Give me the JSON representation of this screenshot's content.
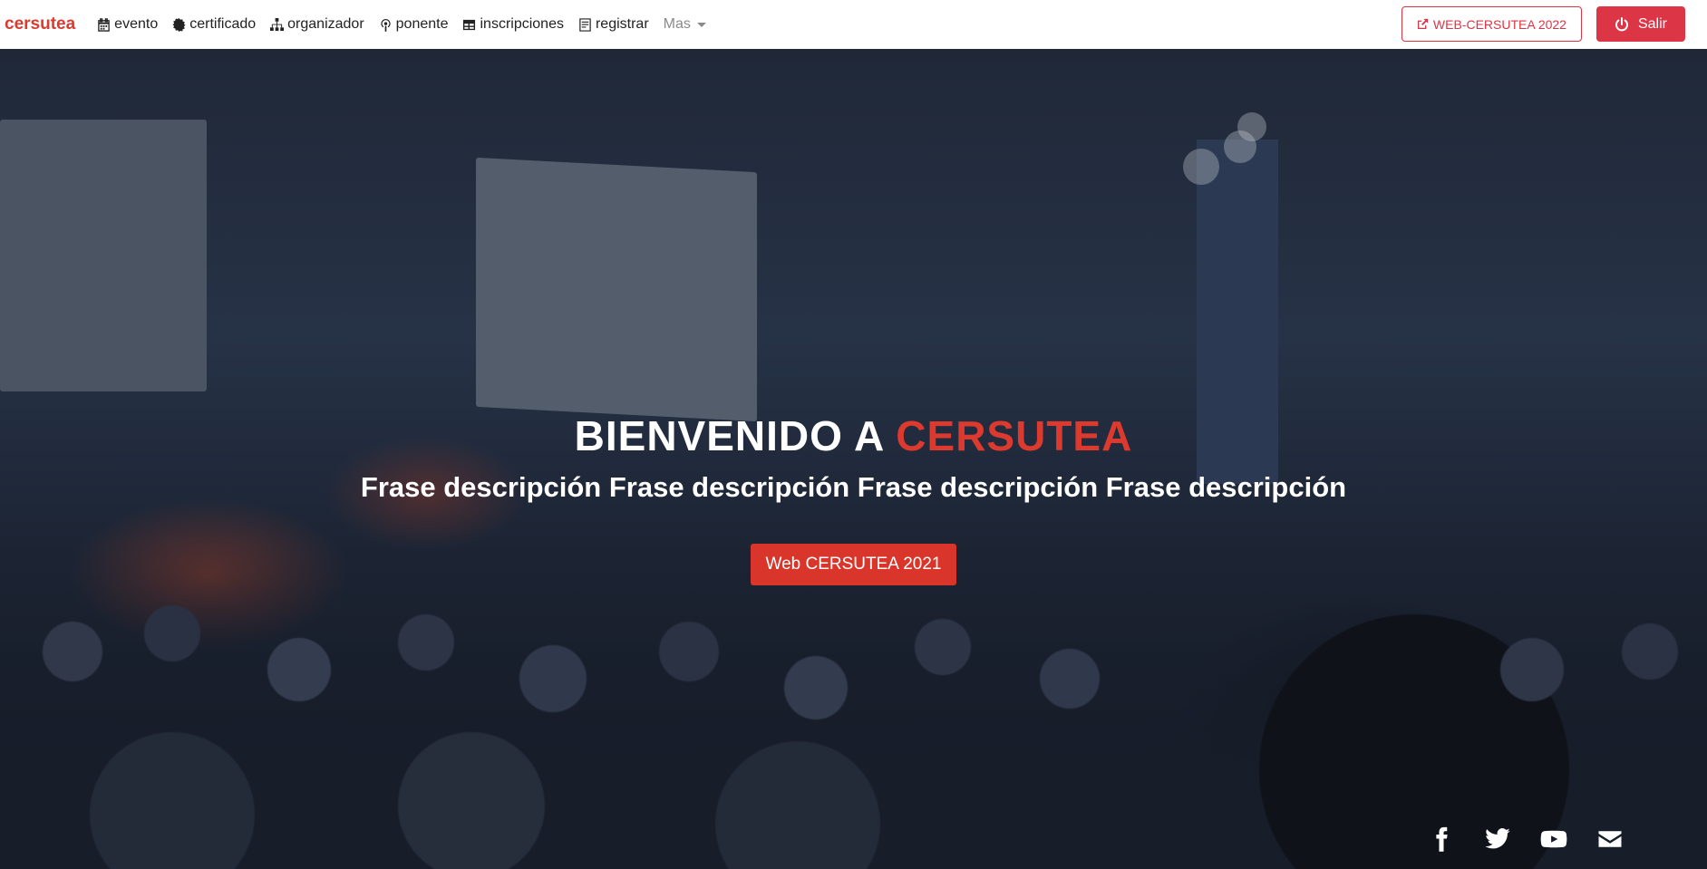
{
  "navbar": {
    "brand": "cersutea",
    "items": [
      {
        "label": "evento",
        "icon": "calendar-icon"
      },
      {
        "label": "certificado",
        "icon": "certificate-icon"
      },
      {
        "label": "organizador",
        "icon": "sitemap-icon"
      },
      {
        "label": "ponente",
        "icon": "podcast-icon"
      },
      {
        "label": "inscripciones",
        "icon": "table-icon"
      },
      {
        "label": "registrar",
        "icon": "registry-icon"
      }
    ],
    "more_label": "Mas",
    "web_button": "WEB-CERSUTEA 2022",
    "logout_button": "Salir"
  },
  "hero": {
    "title_prefix": "BIENVENIDO A ",
    "title_accent": "CERSUTEA",
    "subtitle": "Frase descripción Frase descripción Frase descripción Frase descripción",
    "button": "Web CERSUTEA 2021"
  },
  "social": [
    "facebook-icon",
    "twitter-icon",
    "youtube-icon",
    "envelope-icon"
  ],
  "colors": {
    "accent": "#dc3a2e",
    "danger": "#dc3545",
    "navbar_bg": "#ffffff",
    "hero_overlay": "#1b2233"
  }
}
